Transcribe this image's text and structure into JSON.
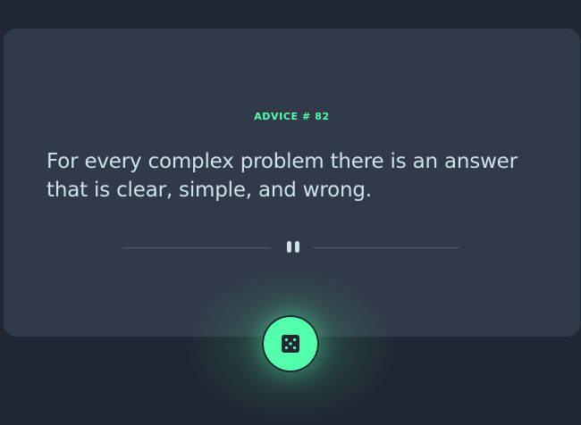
{
  "advice": {
    "title": "ADVICE # 82",
    "text": "For every complex problem there is an answer that is clear, simple, and wrong."
  },
  "divider": {
    "icon": "pause-icon"
  },
  "dice_button": {
    "icon": "dice-icon"
  },
  "colors": {
    "background": "#202733",
    "card": "#313a48",
    "accent": "#53ffaa",
    "text": "#cee3e9",
    "divider": "#4f5d74"
  }
}
